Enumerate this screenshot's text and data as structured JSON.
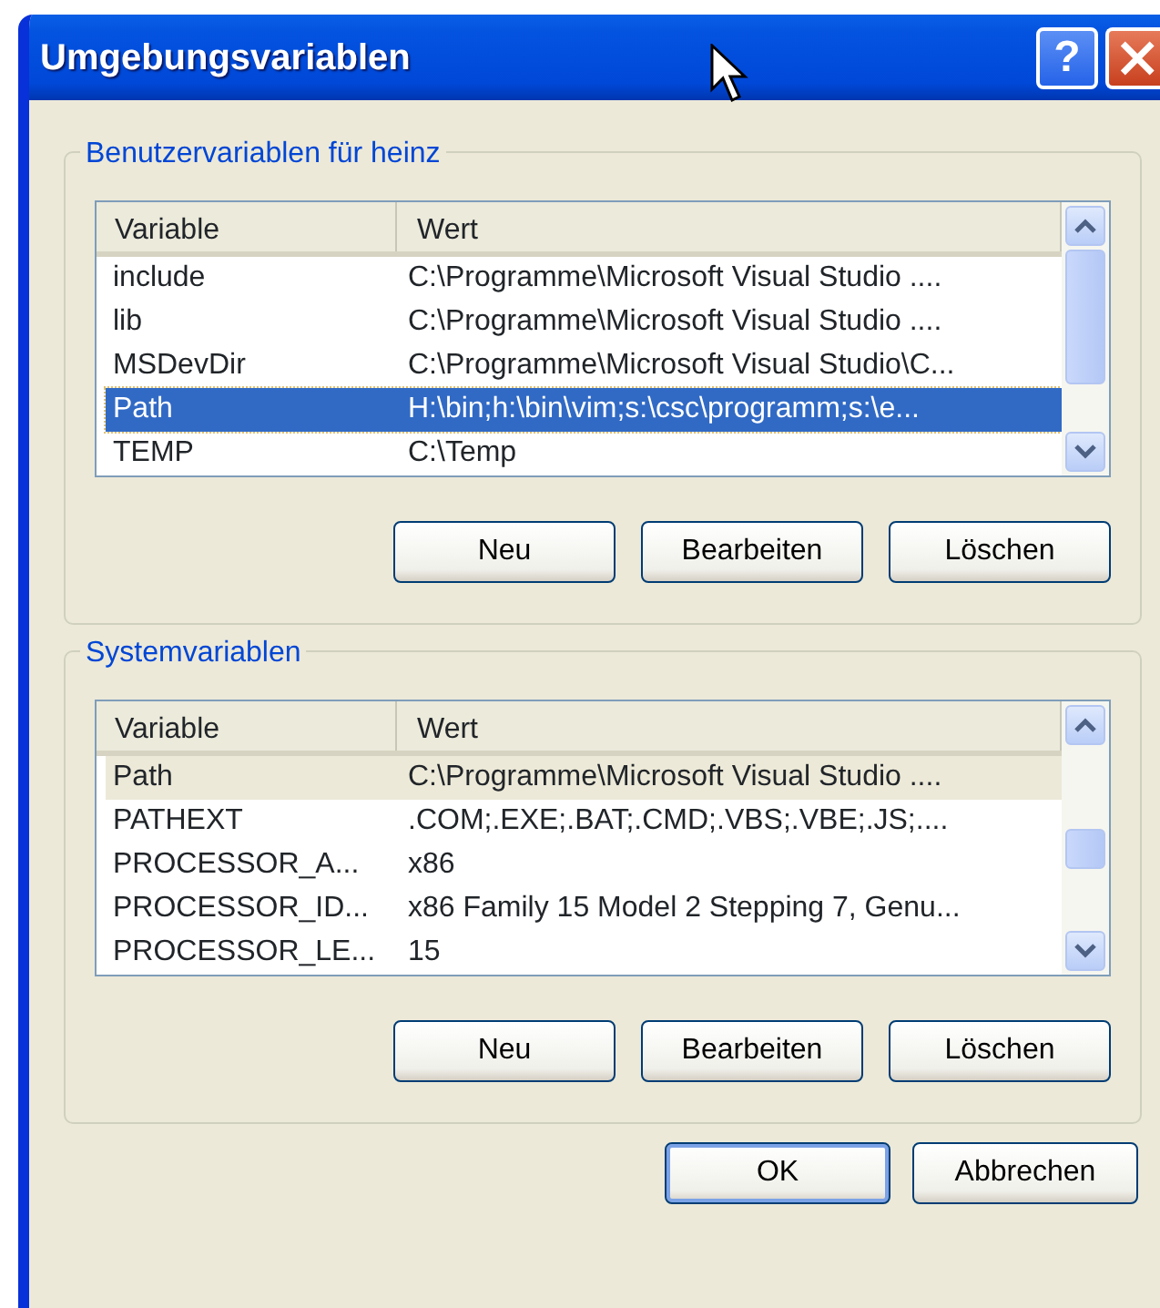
{
  "window": {
    "title": "Umgebungsvariablen",
    "help_button": "?"
  },
  "groups": [
    {
      "title": "Benutzervariablen für heinz",
      "focused": true,
      "columns": [
        "Variable",
        "Wert"
      ],
      "rows": [
        {
          "variable": "include",
          "value": "C:\\Programme\\Microsoft Visual Studio ....",
          "selected": false
        },
        {
          "variable": "lib",
          "value": "C:\\Programme\\Microsoft Visual Studio ....",
          "selected": false
        },
        {
          "variable": "MSDevDir",
          "value": "C:\\Programme\\Microsoft Visual Studio\\C...",
          "selected": false
        },
        {
          "variable": "Path",
          "value": "H:\\bin;h:\\bin\\vim;s:\\csc\\programm;s:\\e...",
          "selected": true
        },
        {
          "variable": "TEMP",
          "value": "C:\\Temp",
          "selected": false
        }
      ],
      "buttons": [
        "Neu",
        "Bearbeiten",
        "Löschen"
      ]
    },
    {
      "title": "Systemvariablen",
      "focused": false,
      "columns": [
        "Variable",
        "Wert"
      ],
      "rows": [
        {
          "variable": "Path",
          "value": "C:\\Programme\\Microsoft Visual Studio ....",
          "selected": true
        },
        {
          "variable": "PATHEXT",
          "value": ".COM;.EXE;.BAT;.CMD;.VBS;.VBE;.JS;....",
          "selected": false
        },
        {
          "variable": "PROCESSOR_A...",
          "value": "x86",
          "selected": false
        },
        {
          "variable": "PROCESSOR_ID...",
          "value": "x86 Family 15 Model 2 Stepping 7, Genu...",
          "selected": false
        },
        {
          "variable": "PROCESSOR_LE...",
          "value": "15",
          "selected": false
        }
      ],
      "buttons": [
        "Neu",
        "Bearbeiten",
        "Löschen"
      ]
    }
  ],
  "footer_buttons": [
    {
      "label": "OK",
      "default": true
    },
    {
      "label": "Abbrechen",
      "default": false
    }
  ]
}
